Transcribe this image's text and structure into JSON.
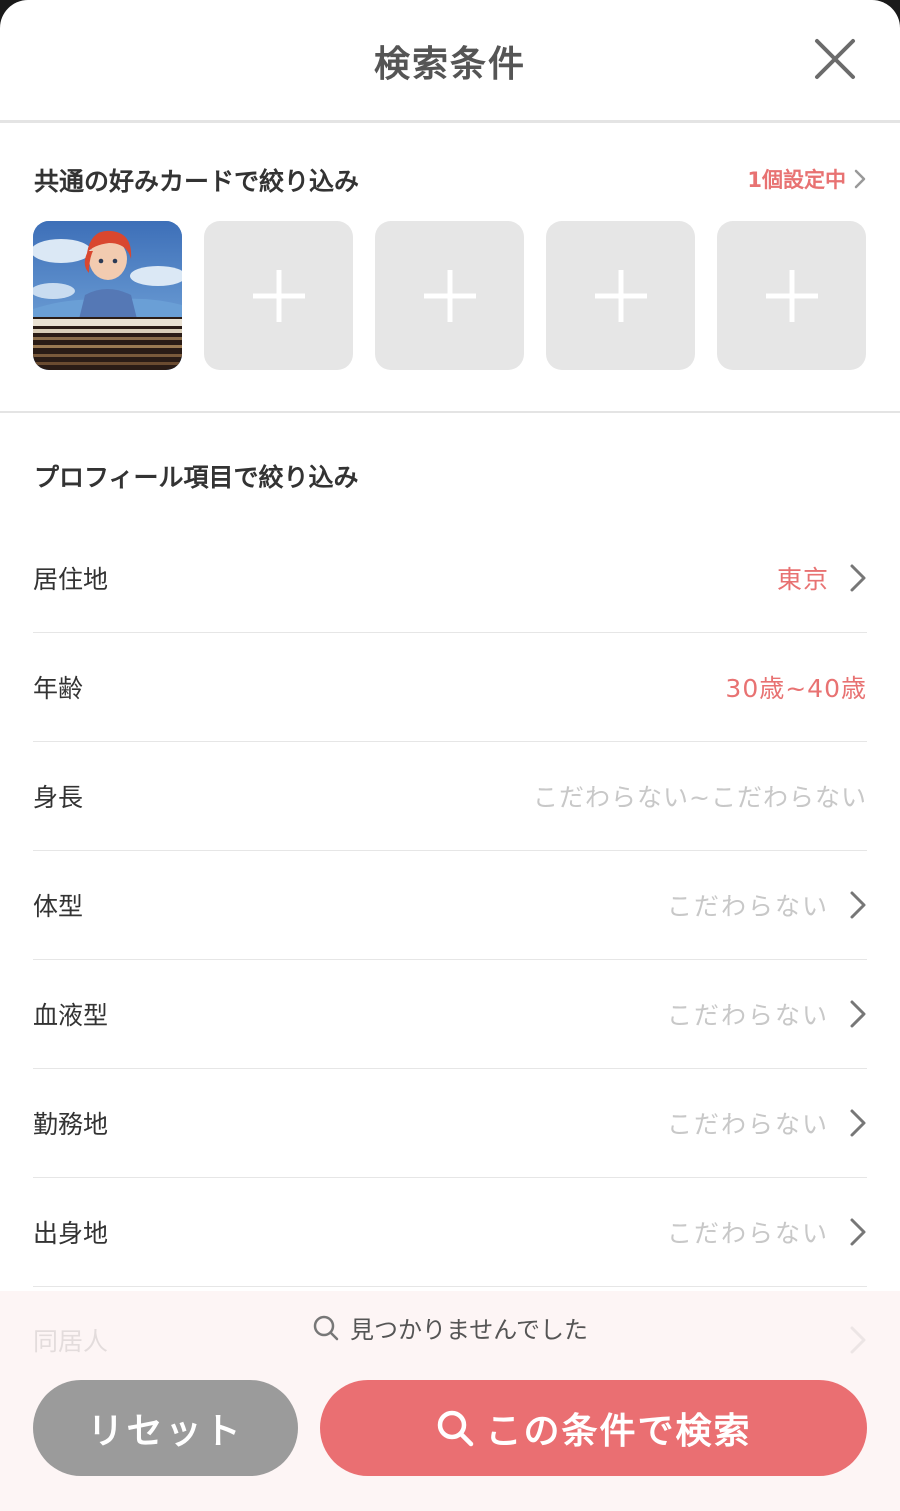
{
  "header": {
    "title": "検索条件"
  },
  "card_section": {
    "title": "共通の好みカードで絞り込み",
    "status": "1個設定中",
    "cards": [
      {
        "type": "image",
        "icon": "anime-image"
      },
      {
        "type": "add",
        "icon": "plus-icon"
      },
      {
        "type": "add",
        "icon": "plus-icon"
      },
      {
        "type": "add",
        "icon": "plus-icon"
      },
      {
        "type": "add",
        "icon": "plus-icon"
      }
    ]
  },
  "profile_section": {
    "title": "プロフィール項目で絞り込み",
    "rows": [
      {
        "label": "居住地",
        "value": "東京",
        "active": true,
        "chevron": true
      },
      {
        "label": "年齢",
        "value": "30歳~40歳",
        "active": true,
        "chevron": false
      },
      {
        "label": "身長",
        "value": "こだわらない~こだわらない",
        "active": false,
        "chevron": false
      },
      {
        "label": "体型",
        "value": "こだわらない",
        "active": false,
        "chevron": true
      },
      {
        "label": "血液型",
        "value": "こだわらない",
        "active": false,
        "chevron": true
      },
      {
        "label": "勤務地",
        "value": "こだわらない",
        "active": false,
        "chevron": true
      },
      {
        "label": "出身地",
        "value": "こだわらない",
        "active": false,
        "chevron": true
      }
    ],
    "partial_row": {
      "label": "同居人"
    }
  },
  "footer": {
    "notice": "見つかりませんでした",
    "reset_label": "リセット",
    "search_label": "この条件で検索"
  },
  "colors": {
    "accent": "#ea6f72",
    "muted": "#c8c8c8",
    "reset": "#9b9b9b"
  }
}
